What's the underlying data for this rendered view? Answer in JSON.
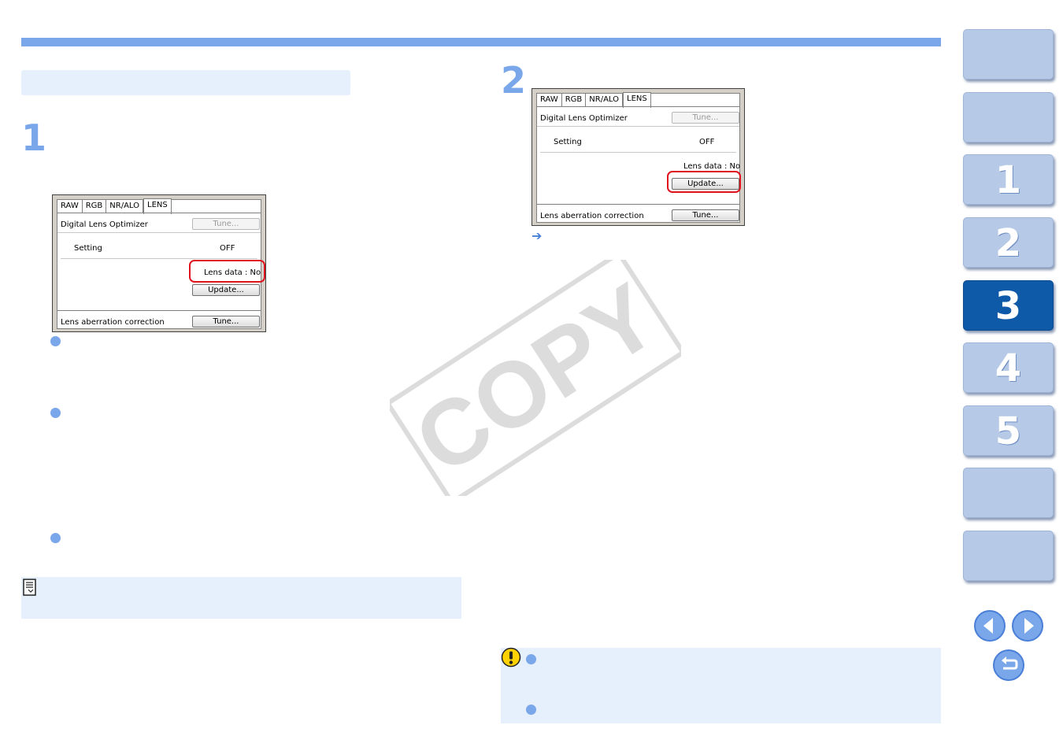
{
  "steps": {
    "step1": "1",
    "step2": "2"
  },
  "dialog1": {
    "tabs": [
      "RAW",
      "RGB",
      "NR/ALO",
      "LENS"
    ],
    "dlo_label": "Digital Lens Optimizer",
    "tune_label": "Tune...",
    "setting_label": "Setting",
    "setting_value": "OFF",
    "lens_data": "Lens data : No",
    "update_label": "Update...",
    "aberration_label": "Lens aberration correction"
  },
  "dialog2": {
    "tabs": [
      "RAW",
      "RGB",
      "NR/ALO",
      "LENS"
    ],
    "dlo_label": "Digital Lens Optimizer",
    "tune_label": "Tune...",
    "setting_label": "Setting",
    "setting_value": "OFF",
    "lens_data": "Lens data : No",
    "update_label": "Update...",
    "aberration_label": "Lens aberration correction"
  },
  "watermark": "COPY",
  "nav": {
    "chapters": [
      "1",
      "2",
      "3",
      "4",
      "5"
    ],
    "active_chapter": "3"
  },
  "colors": {
    "accent": "#7aa6ea",
    "active_nav": "#0f5aa8",
    "highlight": "#e0141e"
  }
}
